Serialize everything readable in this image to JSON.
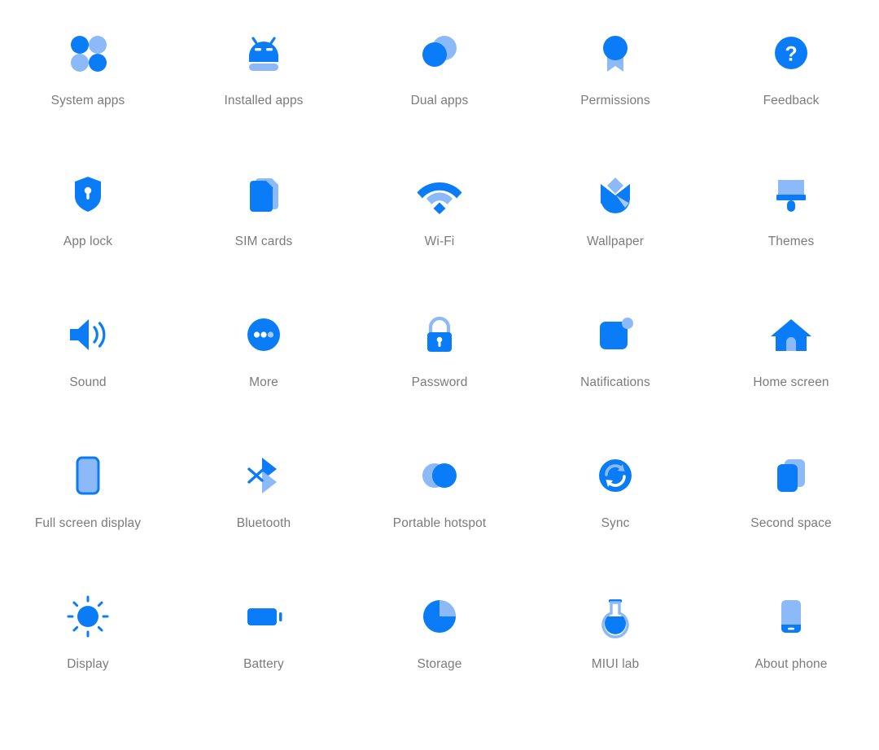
{
  "screen": {
    "title": "Settings icon grid",
    "background_color": "#ffffff",
    "label_color": "#7b7b7b",
    "accent_dark": "#0b7cf7",
    "accent_light": "#8cb9f7",
    "columns": 5,
    "rows": 5
  },
  "items": [
    {
      "label": "System apps",
      "icon": "four-dots-icon",
      "row": 1,
      "col": 1
    },
    {
      "label": "Installed apps",
      "icon": "android-robot-icon",
      "row": 1,
      "col": 2
    },
    {
      "label": "Dual apps",
      "icon": "two-circles-icon",
      "row": 1,
      "col": 3
    },
    {
      "label": "Permissions",
      "icon": "medal-ribbon-icon",
      "row": 1,
      "col": 4
    },
    {
      "label": "Feedback",
      "icon": "question-circle-icon",
      "row": 1,
      "col": 5
    },
    {
      "label": "App lock",
      "icon": "shield-keyhole-icon",
      "row": 2,
      "col": 1
    },
    {
      "label": "SIM cards",
      "icon": "sim-cards-icon",
      "row": 2,
      "col": 2
    },
    {
      "label": "Wi-Fi",
      "icon": "wifi-icon",
      "row": 2,
      "col": 3
    },
    {
      "label": "Wallpaper",
      "icon": "tulip-flower-icon",
      "row": 2,
      "col": 4
    },
    {
      "label": "Themes",
      "icon": "paint-brush-icon",
      "row": 2,
      "col": 5
    },
    {
      "label": "Sound",
      "icon": "speaker-volume-icon",
      "row": 3,
      "col": 1
    },
    {
      "label": "More",
      "icon": "ellipsis-circle-icon",
      "row": 3,
      "col": 2
    },
    {
      "label": "Password",
      "icon": "padlock-icon",
      "row": 3,
      "col": 3
    },
    {
      "label": "Natifications",
      "icon": "badge-square-icon",
      "row": 3,
      "col": 4
    },
    {
      "label": "Home screen",
      "icon": "house-icon",
      "row": 3,
      "col": 5
    },
    {
      "label": "Full screen display",
      "icon": "phone-outline-icon",
      "row": 4,
      "col": 1
    },
    {
      "label": "Bluetooth",
      "icon": "bluetooth-icon",
      "row": 4,
      "col": 2
    },
    {
      "label": "Portable hotspot",
      "icon": "overlap-circles-icon",
      "row": 4,
      "col": 3
    },
    {
      "label": "Sync",
      "icon": "sync-circle-icon",
      "row": 4,
      "col": 4
    },
    {
      "label": "Second space",
      "icon": "stacked-cards-icon",
      "row": 4,
      "col": 5
    },
    {
      "label": "Display",
      "icon": "brightness-sun-icon",
      "row": 5,
      "col": 1
    },
    {
      "label": "Battery",
      "icon": "battery-icon",
      "row": 5,
      "col": 2
    },
    {
      "label": "Storage",
      "icon": "pie-chart-icon",
      "row": 5,
      "col": 3
    },
    {
      "label": "MIUI lab",
      "icon": "flask-icon",
      "row": 5,
      "col": 4
    },
    {
      "label": "About phone",
      "icon": "smartphone-icon",
      "row": 5,
      "col": 5
    }
  ]
}
